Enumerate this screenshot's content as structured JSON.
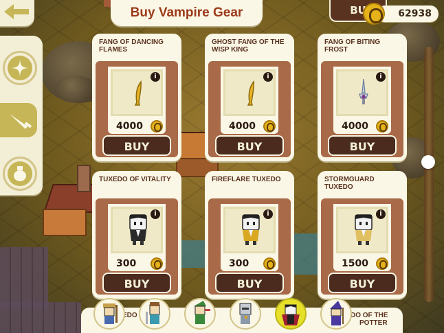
{
  "header": {
    "title": "Buy Vampire Gear",
    "top_buy_stub": "BU",
    "currency": 62938
  },
  "categories": [
    {
      "name": "sparkle",
      "icon": "sparkle-icon",
      "active": false
    },
    {
      "name": "weapons",
      "icon": "sword-icon",
      "active": true
    },
    {
      "name": "potions",
      "icon": "potion-icon",
      "active": false
    }
  ],
  "items": [
    {
      "name": "FANG OF DANCING FLAMES",
      "icon": "golden-fang-icon",
      "price": "4000",
      "buy": "BUY"
    },
    {
      "name": "GHOST FANG OF THE WISP KING",
      "icon": "golden-fang-icon",
      "price": "4000",
      "buy": "BUY"
    },
    {
      "name": "FANG OF BITING FROST",
      "icon": "frost-fang-icon",
      "price": "4000",
      "buy": "BUY"
    },
    {
      "name": "TUXEDO OF VITALITY",
      "icon": "vampire-tuxedo-icon",
      "price": "300",
      "buy": "BUY"
    },
    {
      "name": "FIREFLARE TUXEDO",
      "icon": "vampire-tuxedo-icon",
      "price": "300",
      "buy": "BUY"
    },
    {
      "name": "STORMGUARD TUXEDO",
      "icon": "vampire-tuxedo-icon",
      "price": "1500",
      "buy": "BUY"
    }
  ],
  "bottom_peek": {
    "left_text": "EDO",
    "right_text_line1": "DO OF THE",
    "right_text_line2": "POTTER"
  },
  "characters": [
    {
      "name": "farmer",
      "selected": false
    },
    {
      "name": "knight",
      "selected": false
    },
    {
      "name": "archer",
      "selected": false
    },
    {
      "name": "robot-knight",
      "selected": false
    },
    {
      "name": "vampire",
      "selected": true
    },
    {
      "name": "wizard",
      "selected": false
    }
  ],
  "colors": {
    "title": "#9b3a1a",
    "panel": "#a86a48",
    "buy_button": "#4a2b1d",
    "card": "#fbf7e6",
    "selected_character": "#e7e02a"
  }
}
